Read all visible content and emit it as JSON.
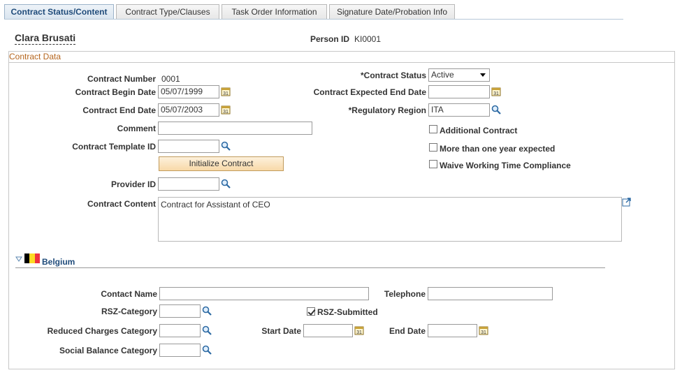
{
  "tabs": [
    {
      "label": "Contract Status/Content",
      "active": true
    },
    {
      "label": "Contract Type/Clauses",
      "active": false
    },
    {
      "label": "Task Order Information",
      "active": false
    },
    {
      "label": "Signature Date/Probation Info",
      "active": false
    }
  ],
  "header": {
    "person_name": "Clara Brusati",
    "person_id_label": "Person ID",
    "person_id": "KI0001"
  },
  "contract_data": {
    "title": "Contract Data",
    "contract_number_label": "Contract Number",
    "contract_number": "0001",
    "begin_date_label": "Contract Begin Date",
    "begin_date": "05/07/1999",
    "end_date_label": "Contract End Date",
    "end_date": "05/07/2003",
    "comment_label": "Comment",
    "comment": "",
    "template_id_label": "Contract Template ID",
    "template_id": "",
    "initialize_button": "Initialize Contract",
    "provider_id_label": "Provider ID",
    "provider_id": "",
    "content_label": "Contract Content",
    "content": "Contract for Assistant of CEO",
    "status_label": "*Contract Status",
    "status_value": "Active",
    "expected_end_label": "Contract Expected End Date",
    "expected_end": "",
    "region_label": "*Regulatory Region",
    "region": "ITA",
    "additional_contract_label": "Additional Contract",
    "additional_contract": false,
    "more_than_year_label": "More than one year expected",
    "more_than_year": false,
    "waive_label": "Waive Working Time Compliance",
    "waive": false
  },
  "belgium": {
    "title": "Belgium",
    "contact_name_label": "Contact Name",
    "contact_name": "",
    "telephone_label": "Telephone",
    "telephone": "",
    "rsz_category_label": "RSZ-Category",
    "rsz_category": "",
    "rsz_submitted_label": "RSZ-Submitted",
    "rsz_submitted": true,
    "reduced_charges_label": "Reduced Charges Category",
    "reduced_charges": "",
    "start_date_label": "Start Date",
    "start_date": "",
    "end_date_label": "End Date",
    "end_date": "",
    "social_balance_label": "Social Balance Category",
    "social_balance": ""
  },
  "colors": {
    "accent_blue": "#1f4b7a",
    "group_title": "#b5651d",
    "flag_black": "#000000",
    "flag_yellow": "#fdda24",
    "flag_red": "#ef3340"
  }
}
